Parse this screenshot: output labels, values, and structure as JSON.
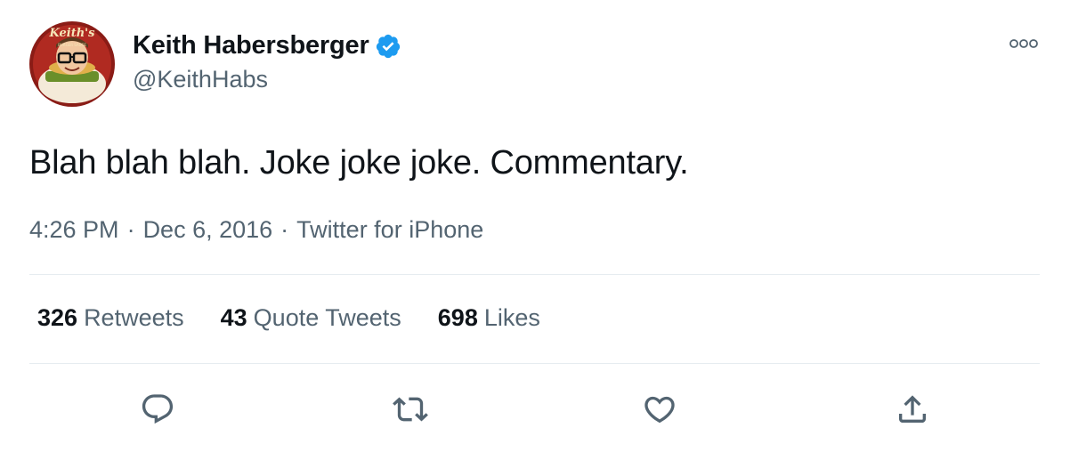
{
  "tweet": {
    "author": {
      "name": "Keith Habersberger",
      "handle": "@KeithHabs",
      "verified": true,
      "avatar_text": "Keith's",
      "avatar_icon": "avatar-image"
    },
    "more_icon": "more-icon",
    "text": "Blah blah blah. Joke joke joke. Commentary.",
    "time": "4:26 PM",
    "separator": "·",
    "date": "Dec 6, 2016",
    "source": "Twitter for iPhone",
    "stats": {
      "retweets": {
        "count": "326",
        "label": "Retweets"
      },
      "quote_tweets": {
        "count": "43",
        "label": "Quote Tweets"
      },
      "likes": {
        "count": "698",
        "label": "Likes"
      }
    },
    "actions": [
      {
        "icon": "reply-icon"
      },
      {
        "icon": "retweet-icon"
      },
      {
        "icon": "like-icon"
      },
      {
        "icon": "share-icon"
      }
    ]
  },
  "colors": {
    "primary_text": "#0f1419",
    "secondary_text": "#536471",
    "verified_blue": "#1d9bf0",
    "divider": "#e6ecf0",
    "icon_gray": "#536471"
  }
}
